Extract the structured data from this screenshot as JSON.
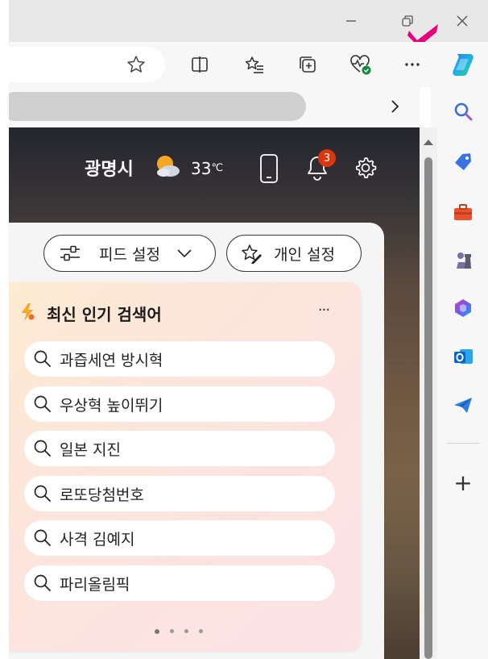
{
  "window": {
    "minimize": "—",
    "restore": "⧉",
    "close": "✕"
  },
  "weather": {
    "city": "광명시",
    "temp": "33",
    "unit": "℃"
  },
  "notifications": {
    "count": "3"
  },
  "feed": {
    "feed_settings": "피드 설정",
    "personal_settings": "개인 설정"
  },
  "trending": {
    "title": "최신 인기 검색어",
    "more": "···",
    "items": [
      "과즙세연 방시혁",
      "우상혁 높이뛰기",
      "일본 지진",
      "로또당첨번호",
      "사격 김예지",
      "파리올림픽"
    ]
  },
  "sidebar": {
    "add": "+"
  },
  "colors": {
    "accent_magenta": "#e6007e",
    "badge": "#d9380e",
    "sidebar_bg": "#f7f7f7"
  }
}
